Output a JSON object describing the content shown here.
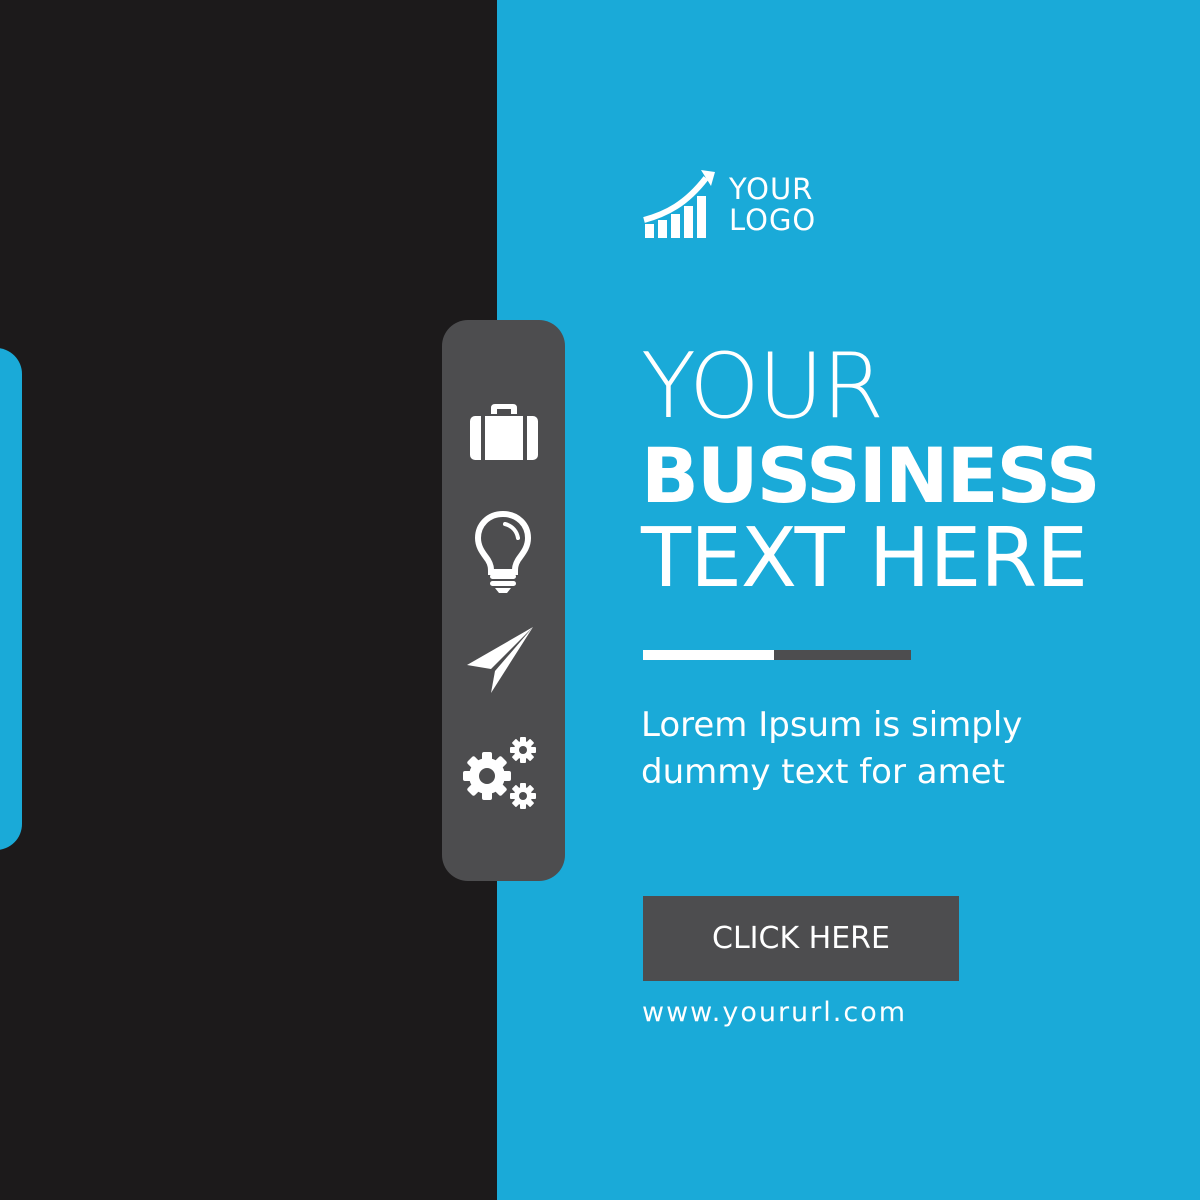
{
  "logo": {
    "line1": "YOUR",
    "line2": "LOGO",
    "icon": "bar-growth-arrow-icon"
  },
  "headline": {
    "line1": "YOUR",
    "line2": "BUSSINESS",
    "line3": "TEXT HERE"
  },
  "subtext": "Lorem Ipsum is simply dummy text for amet",
  "cta": {
    "label": "CLICK HERE"
  },
  "url": "www.yoururl.com",
  "sidebar_icons": [
    "briefcase-icon",
    "lightbulb-icon",
    "paper-plane-icon",
    "gears-icon"
  ],
  "colors": {
    "dark": "#1c1a1b",
    "accent": "#1aaad8",
    "panel": "#4d4d4f",
    "text": "#ffffff"
  }
}
